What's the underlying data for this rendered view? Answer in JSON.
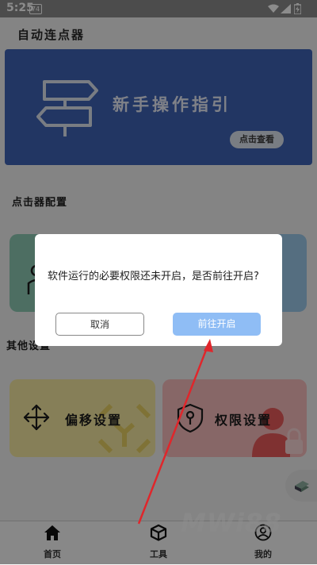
{
  "status_bar": {
    "time": "5:25",
    "notification_badge": "74"
  },
  "app": {
    "title": "自动连点器"
  },
  "banner": {
    "title": "新手操作指引",
    "button_label": "点击查看"
  },
  "sections": {
    "clicker_config": "点击器配置",
    "other_settings": "其他设置"
  },
  "settings_cards": {
    "offset_label": "偏移设置",
    "permission_label": "权限设置"
  },
  "bottom_nav": {
    "home": "首页",
    "tools": "工具",
    "mine": "我的"
  },
  "dialog": {
    "message": "软件运行的必要权限还未开启，是否前往开启?",
    "cancel_label": "取消",
    "confirm_label": "前往开启"
  },
  "watermark": "MWi88",
  "colors": {
    "banner": "#3f63b4",
    "confirm_button": "#8fbdf5",
    "annotation_arrow": "#e0262b"
  }
}
